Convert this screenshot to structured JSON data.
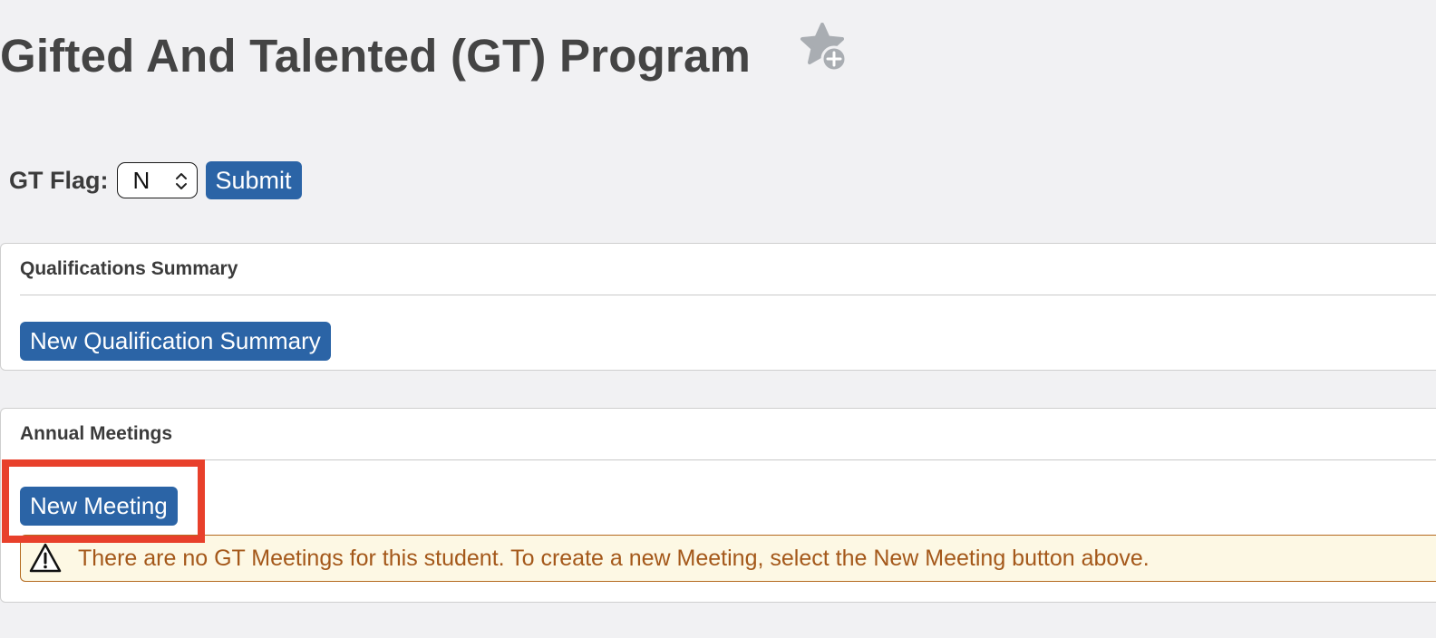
{
  "header": {
    "title": "Gifted And Talented (GT) Program",
    "favorite_icon": "star-plus-icon"
  },
  "gt_flag": {
    "label": "GT Flag:",
    "selected_value": "N",
    "submit_label": "Submit"
  },
  "qualifications": {
    "heading": "Qualifications Summary",
    "button_label": "New Qualification Summary"
  },
  "meetings": {
    "heading": "Annual Meetings",
    "button_label": "New Meeting",
    "empty_message": "There are no GT Meetings for this student. To create a new Meeting, select the New Meeting button above.",
    "warning_icon": "warning-triangle-icon"
  },
  "colors": {
    "background": "#f1f1f3",
    "primary_button": "#2b64a6",
    "warning_text": "#a4581a",
    "warning_bg": "#fdf8e4",
    "highlight": "#e8402b"
  }
}
